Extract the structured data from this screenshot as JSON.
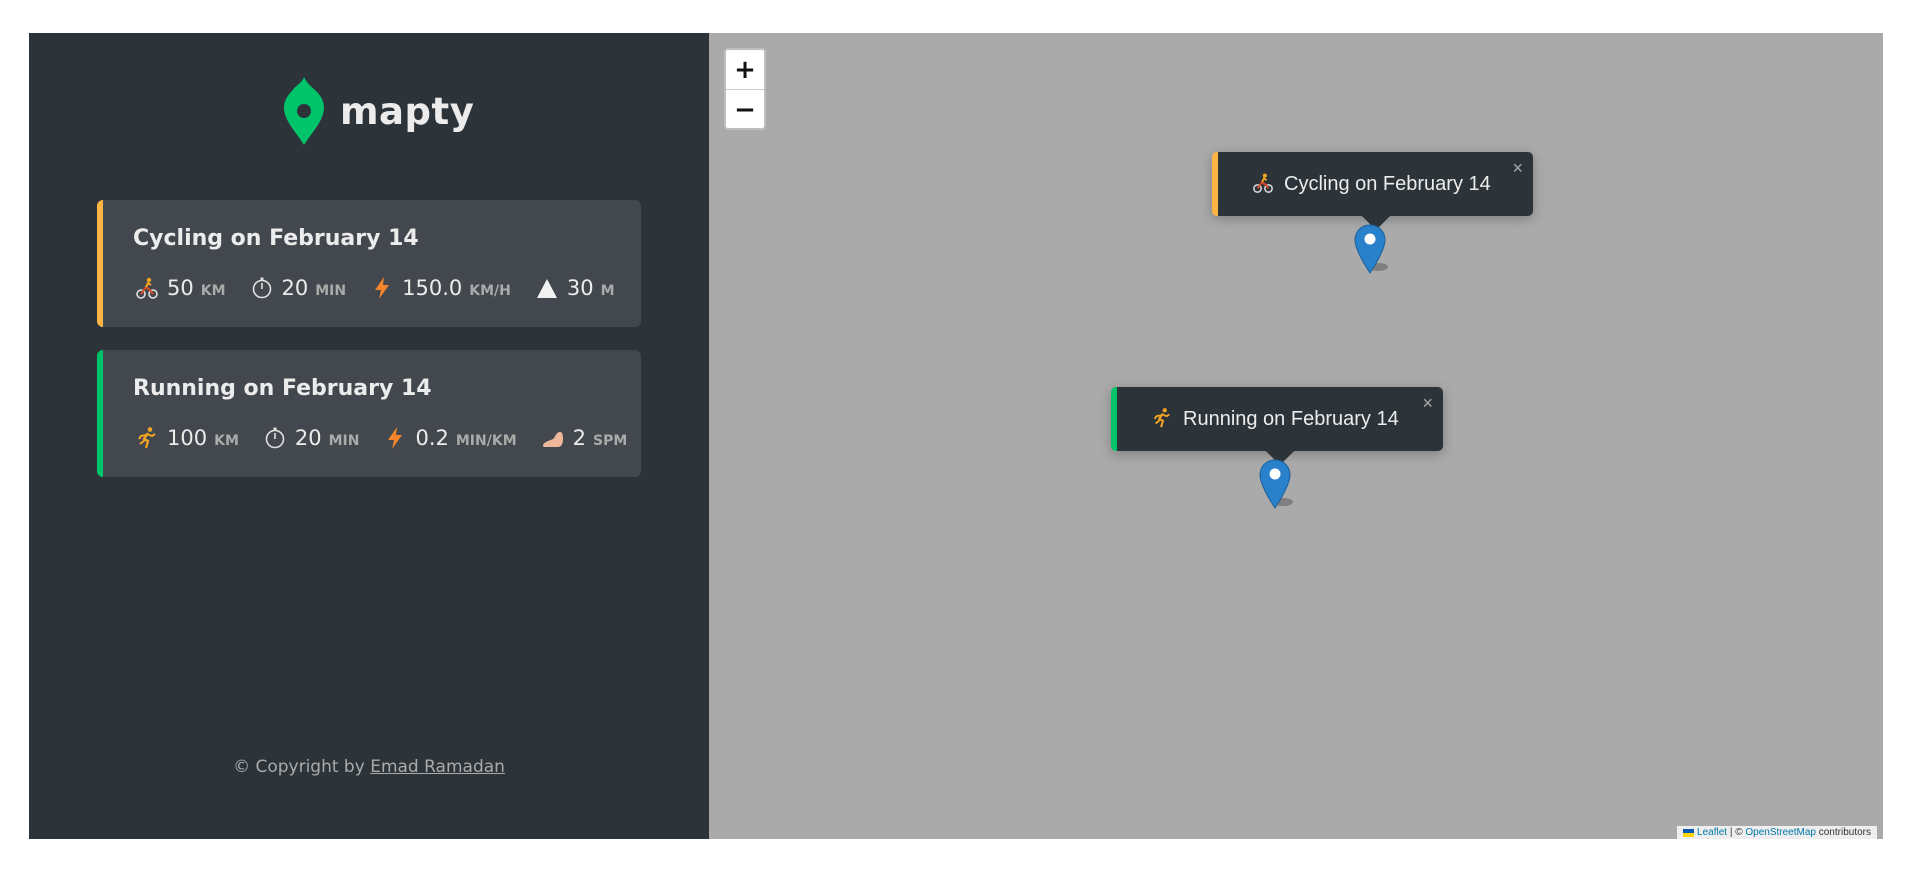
{
  "sidebar": {
    "logo_text": "mapty",
    "workouts": [
      {
        "type": "cycling",
        "title": "Cycling on February 14",
        "accent": "#ffb545",
        "details": [
          {
            "icon": "cyclist-icon",
            "value": "50",
            "unit": "km"
          },
          {
            "icon": "stopwatch-icon",
            "value": "20",
            "unit": "min"
          },
          {
            "icon": "lightning-icon",
            "value": "150.0",
            "unit": "km/h"
          },
          {
            "icon": "mountain-icon",
            "value": "30",
            "unit": "m"
          }
        ]
      },
      {
        "type": "running",
        "title": "Running on February 14",
        "accent": "#00c46a",
        "details": [
          {
            "icon": "runner-icon",
            "value": "100",
            "unit": "km"
          },
          {
            "icon": "stopwatch-icon",
            "value": "20",
            "unit": "min"
          },
          {
            "icon": "lightning-icon",
            "value": "0.2",
            "unit": "min/km"
          },
          {
            "icon": "foot-icon",
            "value": "2",
            "unit": "spm"
          }
        ]
      }
    ],
    "copyright": {
      "prefix": "© Copyright by ",
      "author": "Emad Ramadan"
    }
  },
  "map": {
    "zoom_in": "+",
    "zoom_out": "−",
    "popups": [
      {
        "type": "cycling",
        "icon": "cyclist-icon",
        "text": "Cycling on February 14",
        "close": "×"
      },
      {
        "type": "running",
        "icon": "runner-icon",
        "text": "Running on February 14",
        "close": "×"
      }
    ],
    "attribution": {
      "leaflet": "Leaflet",
      "separator": " | © ",
      "osm": "OpenStreetMap",
      "suffix": " contributors"
    }
  },
  "colors": {
    "sidebar_bg": "#2d3439",
    "card_bg": "#42484d",
    "cycling_accent": "#ffb545",
    "running_accent": "#00c46a",
    "brand_green": "#00c46a",
    "map_bg": "#aaaaaa",
    "marker_blue": "#2a81cb"
  }
}
